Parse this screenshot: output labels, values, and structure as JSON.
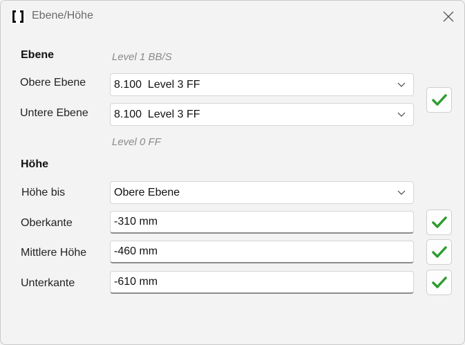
{
  "window": {
    "title": "Ebene/Höhe"
  },
  "ebene": {
    "heading": "Ebene",
    "level_top_hint": "Level 1 BB/S",
    "obere_label": "Obere Ebene",
    "obere_value": "8.100  Level 3 FF",
    "untere_label": "Untere Ebene",
    "untere_value": "8.100  Level 3 FF",
    "level_bottom_hint": "Level 0 FF"
  },
  "hoehe": {
    "heading": "Höhe",
    "hoehe_bis_label": "Höhe bis",
    "hoehe_bis_value": "Obere Ebene",
    "oberkante_label": "Oberkante",
    "oberkante_value": "-310 mm",
    "mittlere_label": "Mittlere Höhe",
    "mittlere_value": "-460 mm",
    "unterkante_label": "Unterkante",
    "unterkante_value": "-610 mm"
  },
  "colors": {
    "check_green": "#2e9d2e",
    "background": "#f3f3f3"
  },
  "icons": [
    "app-icon",
    "close-icon",
    "chevron-down-icon",
    "checkmark-icon"
  ]
}
